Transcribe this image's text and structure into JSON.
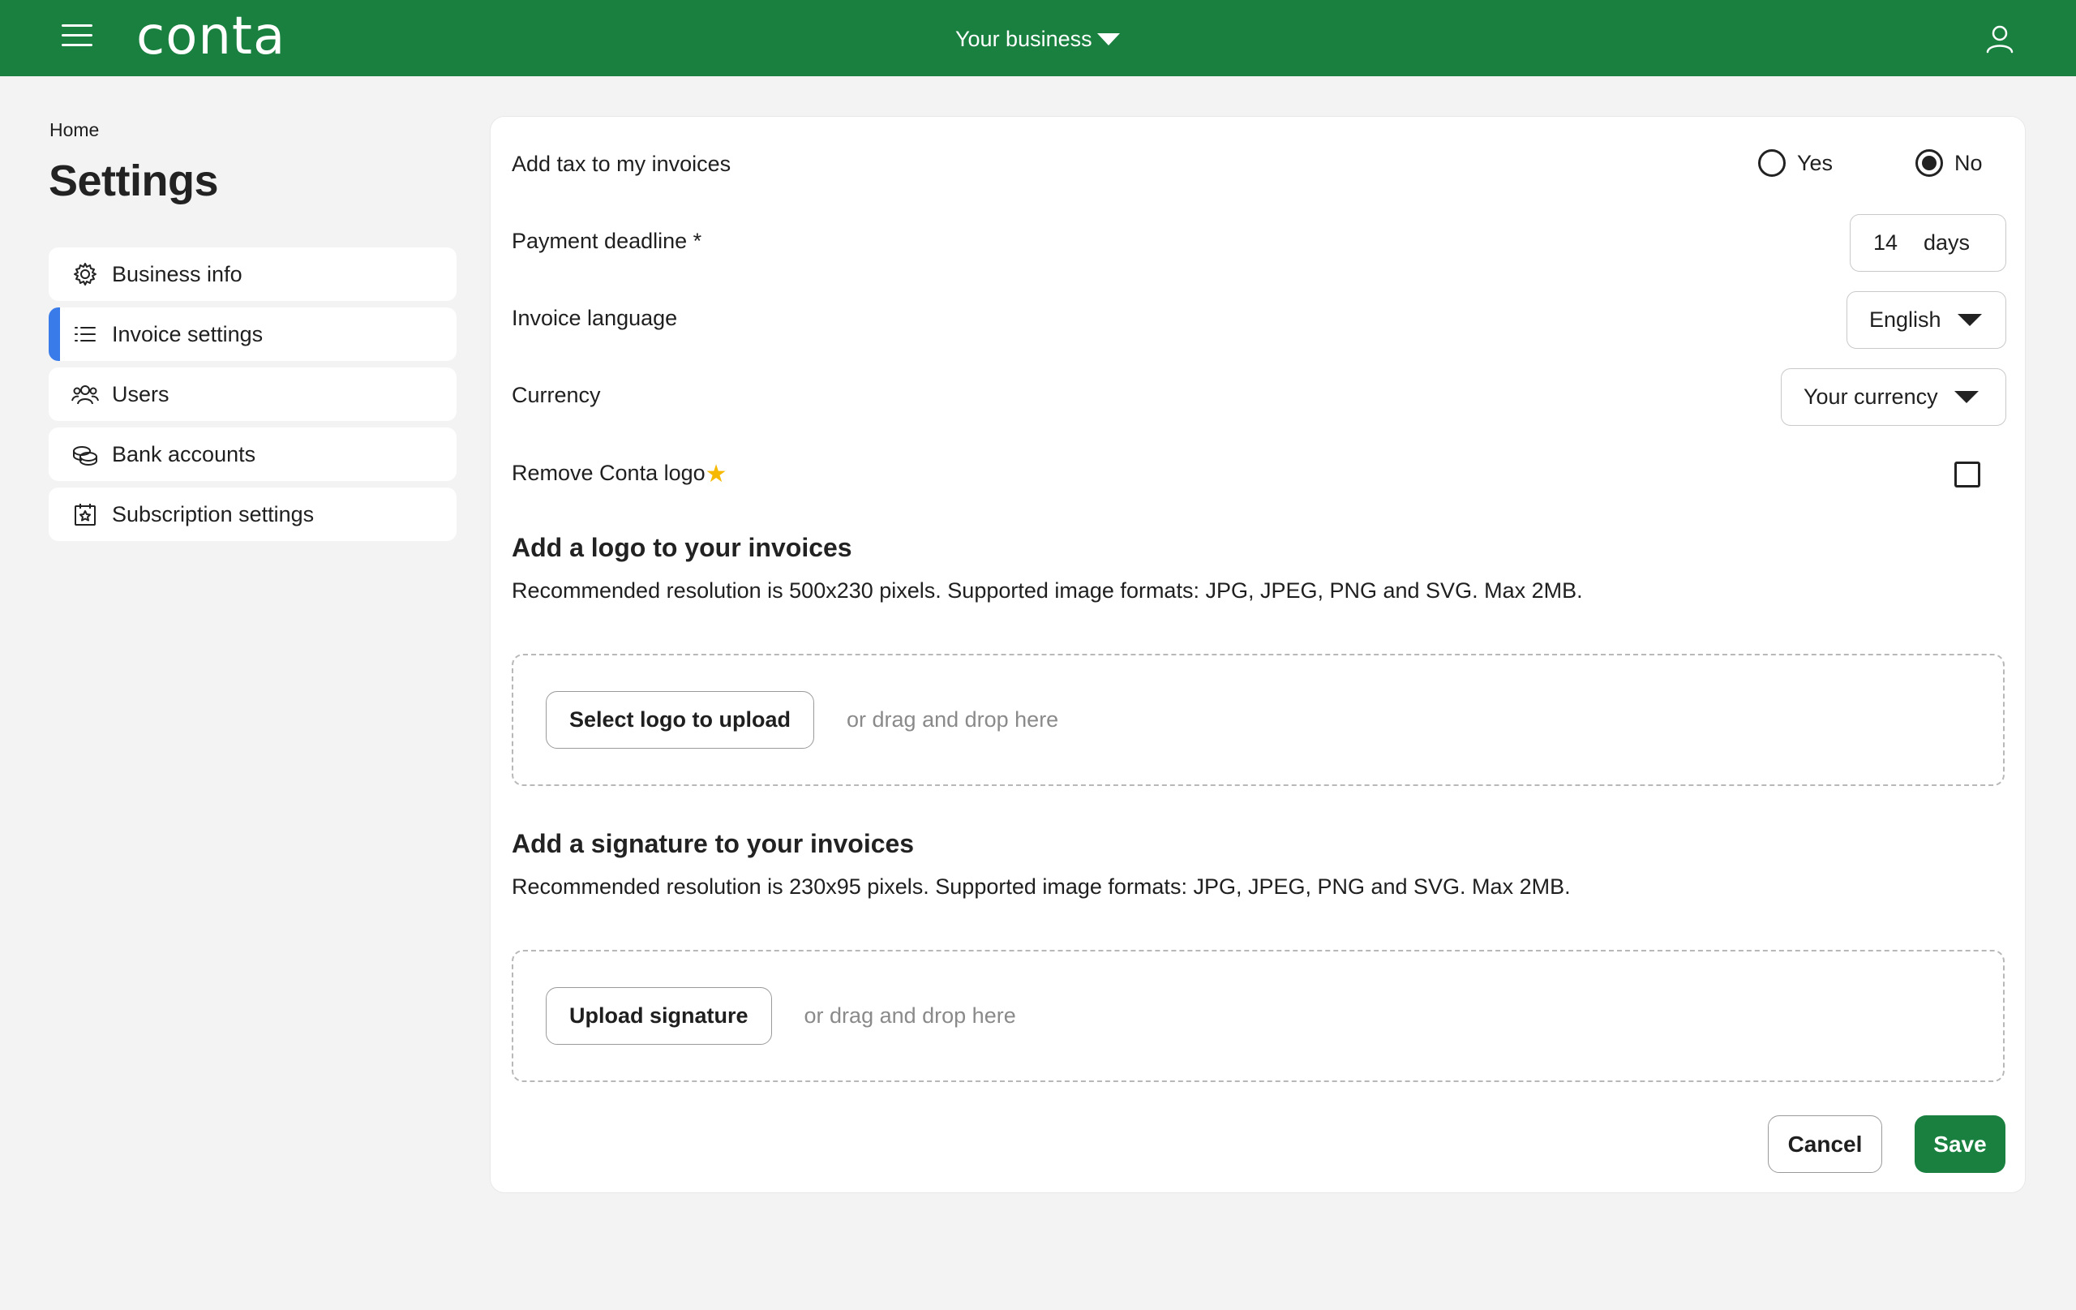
{
  "header": {
    "logo": "conta",
    "business_switch": "Your business",
    "icons": [
      "hamburger-menu-icon",
      "chevron-down-icon",
      "user-icon"
    ]
  },
  "breadcrumb": "Home",
  "page_title": "Settings",
  "sidebar": {
    "items": [
      {
        "label": "Business info",
        "icon": "gear-icon",
        "active": false
      },
      {
        "label": "Invoice settings",
        "icon": "list-icon",
        "active": true
      },
      {
        "label": "Users",
        "icon": "users-icon",
        "active": false
      },
      {
        "label": "Bank accounts",
        "icon": "coins-icon",
        "active": false
      },
      {
        "label": "Subscription settings",
        "icon": "calendar-star-icon",
        "active": false
      }
    ]
  },
  "form": {
    "tax": {
      "label": "Add tax to my invoices",
      "yes": "Yes",
      "no": "No",
      "selected": "No"
    },
    "deadline": {
      "label": "Payment deadline *",
      "value": "14",
      "unit": "days"
    },
    "language": {
      "label": "Invoice language",
      "value": "English"
    },
    "currency": {
      "label": "Currency",
      "value": "Your currency"
    },
    "remove_logo": {
      "label": "Remove Conta logo",
      "checked": false,
      "badge_icon": "star-icon"
    }
  },
  "logo_section": {
    "title": "Add a logo to your invoices",
    "description": "Recommended resolution is 500x230 pixels. Supported image formats: JPG, JPEG, PNG and SVG. Max 2MB.",
    "button": "Select logo to upload",
    "hint": "or drag and drop here"
  },
  "signature_section": {
    "title": "Add a signature to your invoices",
    "description": "Recommended resolution is 230x95 pixels. Supported image formats: JPG, JPEG, PNG and SVG. Max 2MB.",
    "button": "Upload signature",
    "hint": "or drag and drop here"
  },
  "actions": {
    "cancel": "Cancel",
    "save": "Save"
  },
  "colors": {
    "brand": "#1a8040",
    "active_indicator": "#3a7bea",
    "star": "#f6b900"
  }
}
